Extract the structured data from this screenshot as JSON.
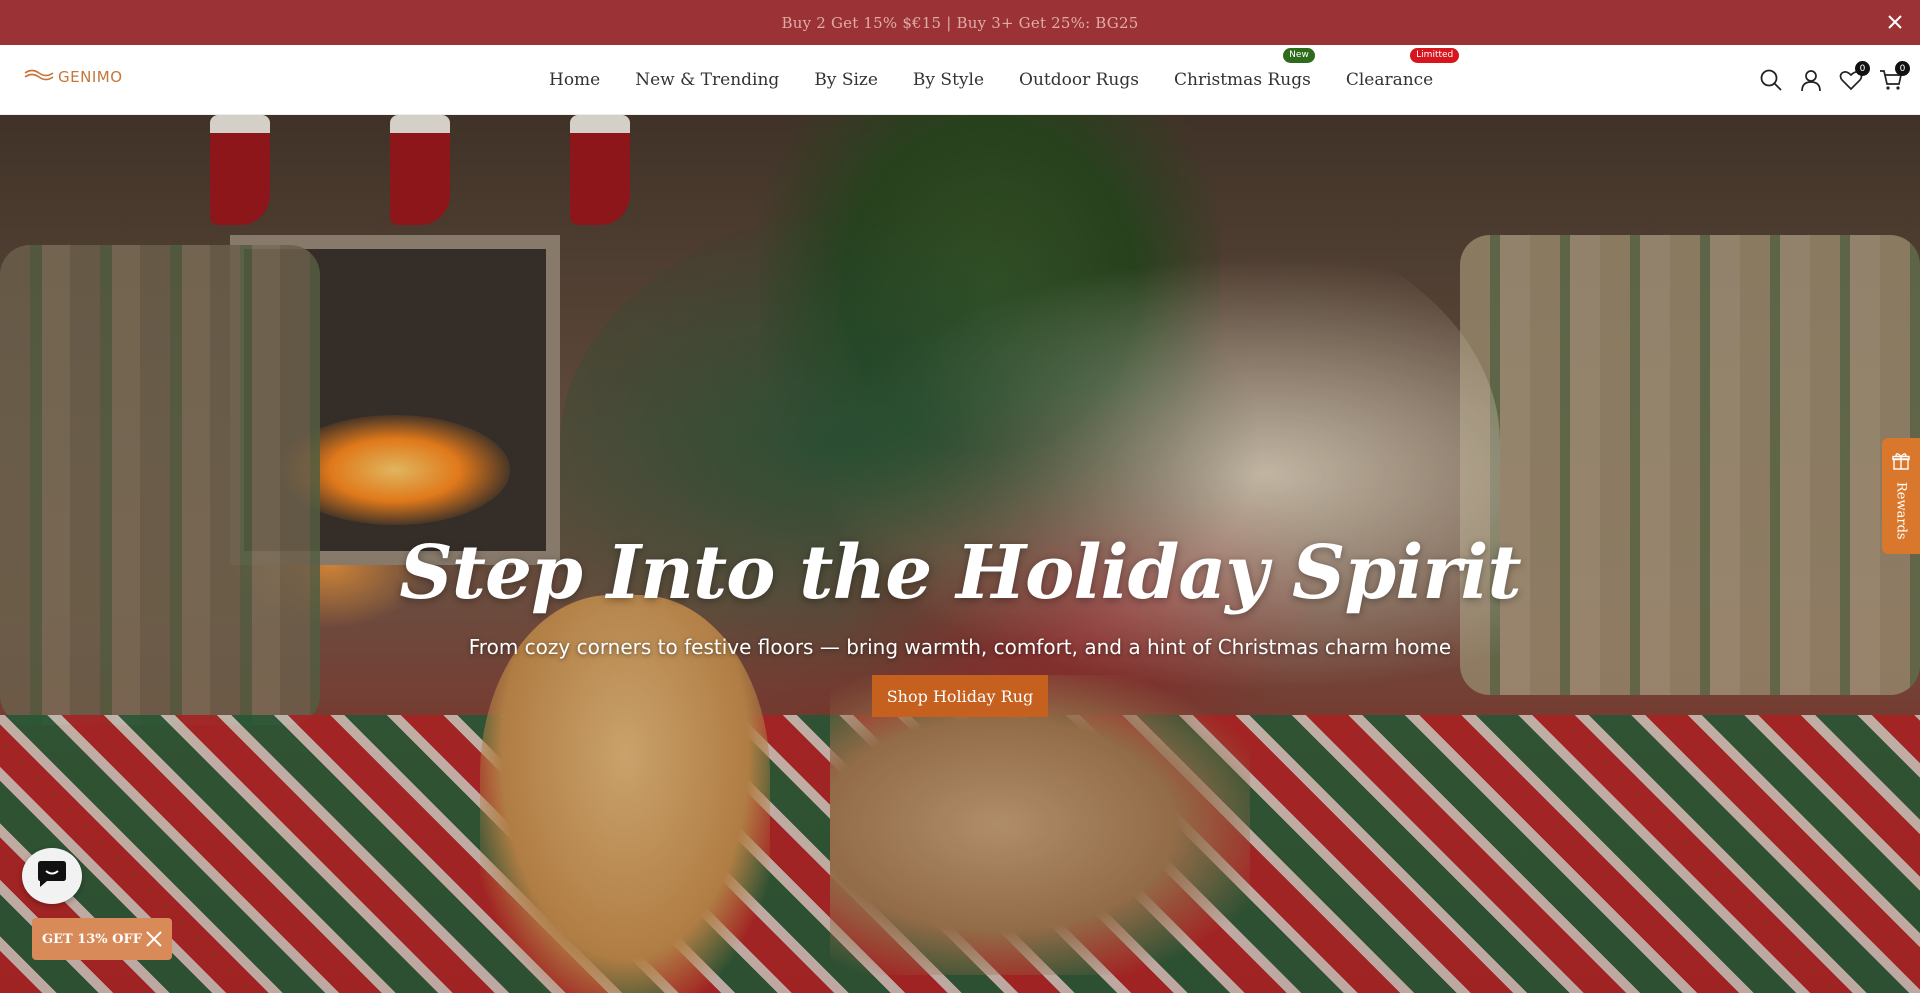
{
  "announcement": {
    "text": "Buy 2 Get 15% $€15 | Buy 3+ Get 25%: BG25",
    "close_icon": "close-icon"
  },
  "header": {
    "logo_text": "GENIMO",
    "nav": [
      {
        "label": "Home"
      },
      {
        "label": "New & Trending"
      },
      {
        "label": "By Size"
      },
      {
        "label": "By Style"
      },
      {
        "label": "Outdoor Rugs"
      },
      {
        "label": "Christmas Rugs",
        "badge": "New"
      },
      {
        "label": "Clearance",
        "badge": "Limitted"
      }
    ],
    "wishlist_count": "0",
    "cart_count": "0"
  },
  "hero": {
    "title": "Step Into the Holiday Spirit",
    "subtitle": "From cozy corners to festive floors — bring warmth, comfort, and a hint of Christmas charm home",
    "cta": "Shop Holiday Rug"
  },
  "rewards": {
    "label": "Rewards"
  },
  "discount": {
    "label": "GET 13% OFF"
  },
  "colors": {
    "announcement_bg": "#9b3236",
    "cta_bg": "#c5601f",
    "rewards_bg": "#d9782c",
    "badge_new": "#2f6b1c",
    "badge_limited": "#d8141d"
  }
}
